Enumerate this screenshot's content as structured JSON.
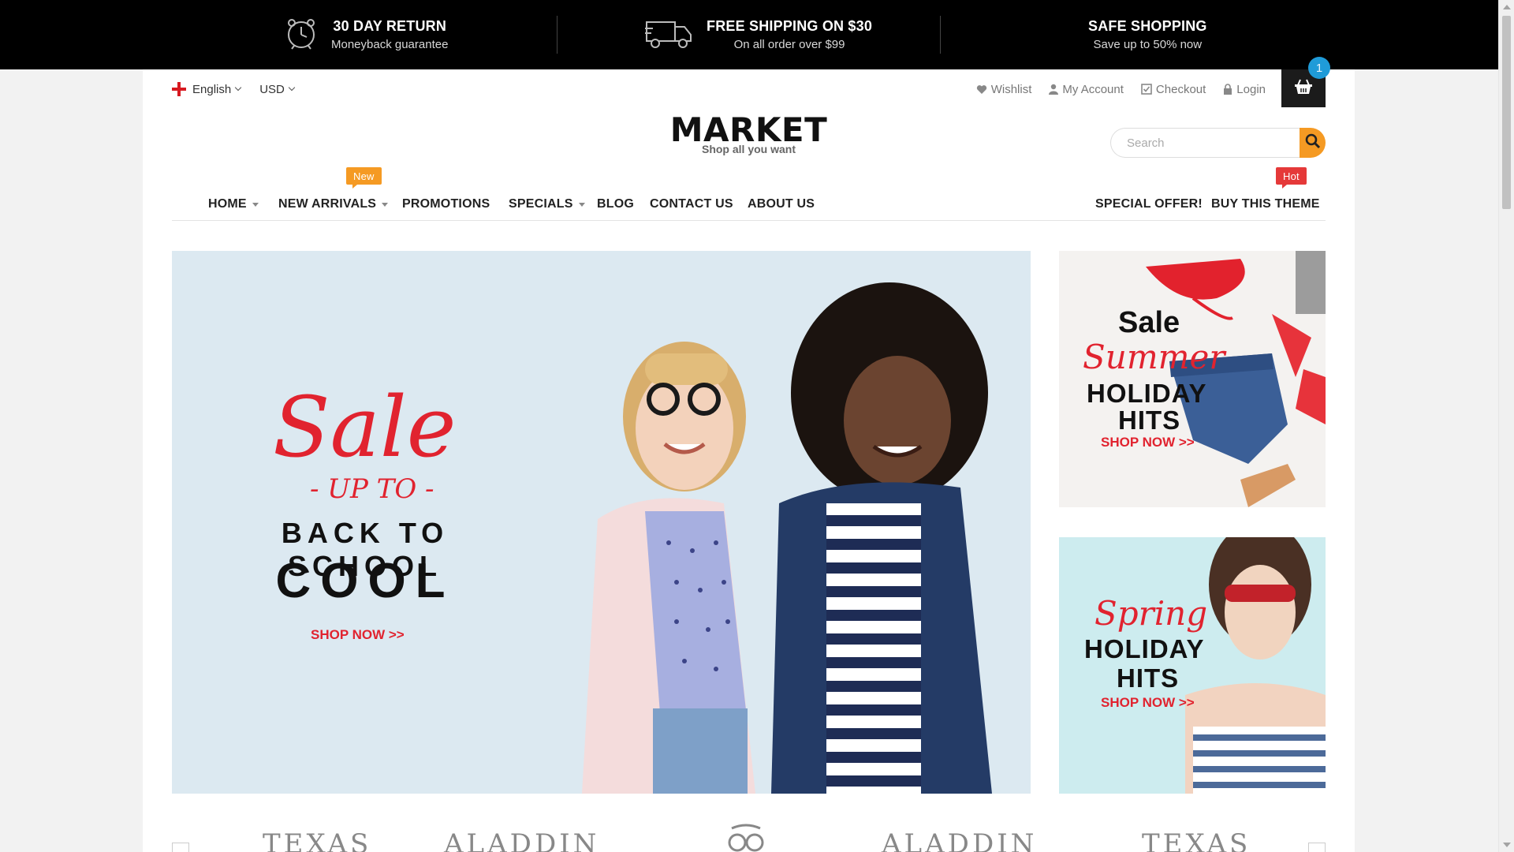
{
  "topbar": {
    "items": [
      {
        "title": "30 DAY RETURN",
        "subtitle": "Moneyback guarantee",
        "icon": "alarm-clock-icon"
      },
      {
        "title": "FREE SHIPPING ON $30",
        "subtitle": "On all order over $99",
        "icon": "delivery-truck-icon"
      },
      {
        "title": "SAFE SHOPPING",
        "subtitle": "Save up to 50% now",
        "icon": ""
      }
    ]
  },
  "header": {
    "language": "English",
    "currency": "USD",
    "links": {
      "wishlist": "Wishlist",
      "account": "My Account",
      "checkout": "Checkout",
      "login": "Login"
    },
    "cart_count": "1",
    "logo_title": "MARKET",
    "logo_tagline": "Shop all you want",
    "search_placeholder": "Search"
  },
  "nav": {
    "items": [
      "HOME",
      "NEW ARRIVALS",
      "PROMOTIONS",
      "SPECIALS",
      "BLOG",
      "CONTACT US",
      "ABOUT US"
    ],
    "right_items": [
      "SPECIAL OFFER!",
      "BUY THIS THEME"
    ],
    "new_tag": "New",
    "hot_tag": "Hot"
  },
  "hero": {
    "script": "Sale",
    "upto": "- UP TO -",
    "line1": "BACK TO SCHOOL",
    "line2": "COOL",
    "cta": "SHOP NOW >>"
  },
  "side_banner_1": {
    "line1": "Sale",
    "script": "Summer",
    "line2": "HOLIDAY",
    "line3": "HITS",
    "cta": "SHOP NOW >>"
  },
  "side_banner_2": {
    "script": "Spring",
    "line1": "HOLIDAY",
    "line2": "HITS",
    "cta": "SHOP NOW >>"
  },
  "brands": [
    "TEXAS",
    "ALADDIN",
    "ALADDIN",
    "TEXAS"
  ],
  "colors": {
    "accent": "#f59a23",
    "sale_red": "#e1232f",
    "hot_red": "#e53939",
    "cart_badge": "#1f9bd8"
  }
}
